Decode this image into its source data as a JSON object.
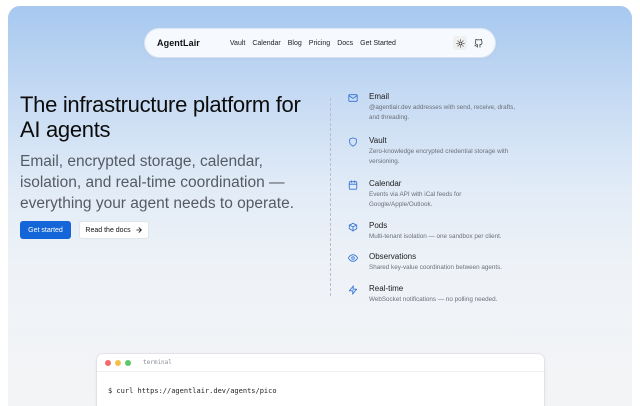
{
  "nav": {
    "logo": "AgentLair",
    "links": [
      "Vault",
      "Calendar",
      "Blog",
      "Pricing",
      "Docs",
      "Get Started"
    ],
    "icons": [
      "sun-icon",
      "github-icon"
    ]
  },
  "hero": {
    "title": "The infrastructure platform for AI agents",
    "subtitle": "Email, encrypted storage, calendar, isolation, and real-time coordination — everything your agent needs to operate.",
    "primary_button": "Get started",
    "secondary_button": "Read the docs",
    "secondary_icon": "arrow-right-icon"
  },
  "features": [
    {
      "title": "Email",
      "desc": "@agentlair.dev addresses with send, receive, drafts, and threading.",
      "icon": "mail-icon"
    },
    {
      "title": "Vault",
      "desc": "Zero-knowledge encrypted credential storage with versioning.",
      "icon": "shield-icon"
    },
    {
      "title": "Calendar",
      "desc": "Events via API with iCal feeds for Google/Apple/Outlook.",
      "icon": "calendar-icon"
    },
    {
      "title": "Pods",
      "desc": "Multi-tenant isolation — one sandbox per client.",
      "icon": "box-icon"
    },
    {
      "title": "Observations",
      "desc": "Shared key-value coordination between agents.",
      "icon": "eye-icon"
    },
    {
      "title": "Real-time",
      "desc": "WebSocket notifications — no polling needed.",
      "icon": "lightning-icon"
    }
  ],
  "terminal": {
    "title": "terminal",
    "command": "$ curl https://agentlair.dev/agents/pico"
  },
  "colors": {
    "accent": "#1466d8",
    "icon_blue": "#2f6fd6",
    "dot_red": "#f26a6a",
    "dot_yellow": "#f5c04a",
    "dot_green": "#5dc76a"
  }
}
